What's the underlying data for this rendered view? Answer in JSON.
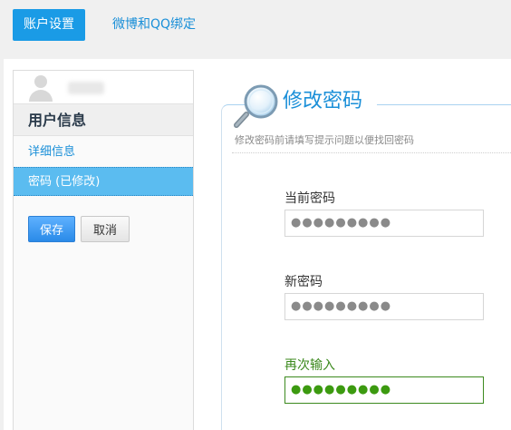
{
  "tabs": {
    "account_settings": "账户设置",
    "weibo_qq_binding": "微博和QQ绑定"
  },
  "sidebar": {
    "section_title": "用户信息",
    "items": [
      {
        "label": "详细信息"
      },
      {
        "label": "密码 (已修改)"
      }
    ],
    "save_label": "保存",
    "cancel_label": "取消"
  },
  "form": {
    "title": "修改密码",
    "description": "修改密码前请填写提示问题以便找回密码",
    "fields": [
      {
        "label": "当前密码",
        "value": "●●●●●●●●●"
      },
      {
        "label": "新密码",
        "value": "●●●●●●●●●"
      },
      {
        "label": "再次输入",
        "value": "●●●●●●●●●"
      }
    ]
  },
  "colors": {
    "accent": "#1a9be6",
    "active_item": "#5bbcf0",
    "focus_green": "#3c8a1e"
  }
}
